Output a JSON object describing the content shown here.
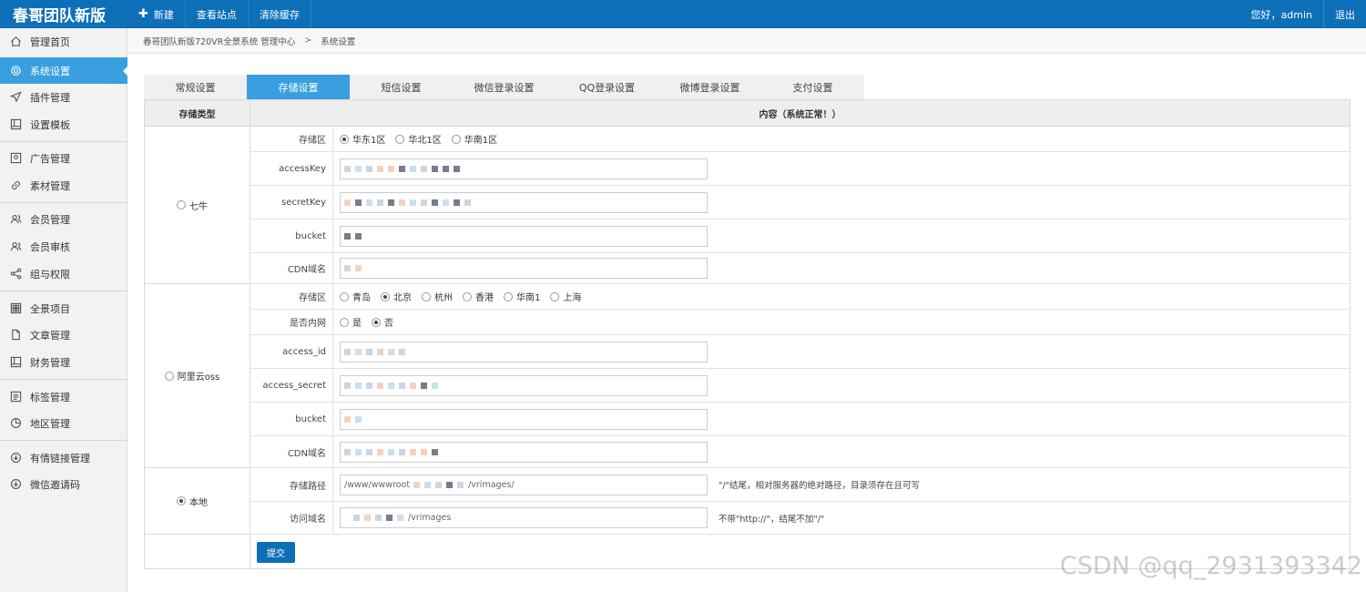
{
  "app": {
    "title": "春哥团队新版"
  },
  "topnav": {
    "new_label": "新建",
    "view_site": "查看站点",
    "clear_cache": "清除缓存",
    "greeting": "您好，admin",
    "logout": "退出"
  },
  "sidebar": {
    "items": [
      {
        "label": "管理首页",
        "icon": "home-icon"
      },
      {
        "label": "系统设置",
        "icon": "gear-icon"
      },
      {
        "label": "插件管理",
        "icon": "send-icon"
      },
      {
        "label": "设置模板",
        "icon": "template-icon"
      },
      {
        "label": "广告管理",
        "icon": "ad-icon"
      },
      {
        "label": "素材管理",
        "icon": "link-icon"
      },
      {
        "label": "会员管理",
        "icon": "users-icon"
      },
      {
        "label": "会员审核",
        "icon": "user-check-icon"
      },
      {
        "label": "组与权限",
        "icon": "share-icon"
      },
      {
        "label": "全景项目",
        "icon": "grid-icon"
      },
      {
        "label": "文章管理",
        "icon": "file-icon"
      },
      {
        "label": "财务管理",
        "icon": "book-icon"
      },
      {
        "label": "标签管理",
        "icon": "list-icon"
      },
      {
        "label": "地区管理",
        "icon": "pie-icon"
      },
      {
        "label": "有情链接管理",
        "icon": "download-icon"
      },
      {
        "label": "微信邀请码",
        "icon": "download-icon"
      }
    ]
  },
  "breadcrumb": {
    "root": "春哥团队新版720VR全景系统 管理中心",
    "sep": ">",
    "current": "系统设置"
  },
  "tabs": [
    "常规设置",
    "存储设置",
    "短信设置",
    "微信登录设置",
    "QQ登录设置",
    "微博登录设置",
    "支付设置"
  ],
  "active_tab": "存储设置",
  "table": {
    "col1": "存储类型",
    "col2": "内容（系统正常！）",
    "qiniu": {
      "name": "七牛",
      "region_label": "存储区",
      "regions": [
        "华东1区",
        "华北1区",
        "华南1区"
      ],
      "selected_region": "华东1区",
      "access_key_label": "accessKey",
      "secret_key_label": "secretKey",
      "bucket_label": "bucket",
      "cdn_label": "CDN域名"
    },
    "aliyun": {
      "name": "阿里云oss",
      "region_label": "存储区",
      "regions": [
        "青岛",
        "北京",
        "杭州",
        "香港",
        "华南1",
        "上海"
      ],
      "selected_region": "北京",
      "intranet_label": "是否内网",
      "intranet_options": [
        "是",
        "否"
      ],
      "intranet_selected": "否",
      "access_id_label": "access_id",
      "access_secret_label": "access_secret",
      "bucket_label": "bucket",
      "cdn_label": "CDN域名"
    },
    "local": {
      "name": "本地",
      "selected": true,
      "path_label": "存储路径",
      "path_prefix": "/www/wwwroot",
      "path_suffix": "/vrimages/",
      "path_hint": "\"/\"结尾，相对服务器的绝对路径，目录须存在且可写",
      "domain_label": "访问域名",
      "domain_suffix": "/vrimages",
      "domain_hint": "不带\"http://\"，结尾不加\"/\""
    },
    "submit_label": "提交"
  },
  "watermark": "CSDN @qq_2931393342"
}
